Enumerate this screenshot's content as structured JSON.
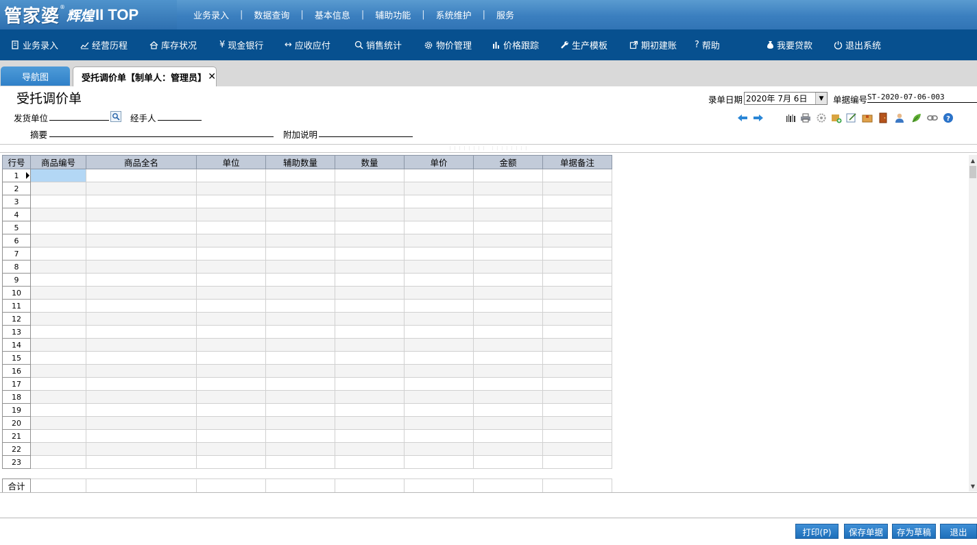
{
  "app": {
    "brand": "管家婆",
    "brand_mark": "®",
    "brand_sub": "辉煌",
    "brand_version": "II TOP"
  },
  "top_menu": [
    "业务录入",
    "数据查询",
    "基本信息",
    "辅助功能",
    "系统维护",
    "服务"
  ],
  "nav": [
    {
      "label": "业务录入",
      "icon": "doc-icon"
    },
    {
      "label": "经营历程",
      "icon": "trend-icon"
    },
    {
      "label": "库存状况",
      "icon": "home-icon"
    },
    {
      "label": "现金银行",
      "icon": "yen-icon"
    },
    {
      "label": "应收应付",
      "icon": "arrows-icon"
    },
    {
      "label": "销售统计",
      "icon": "search-icon"
    },
    {
      "label": "物价管理",
      "icon": "gear-icon"
    },
    {
      "label": "价格跟踪",
      "icon": "bar-chart-icon"
    },
    {
      "label": "生产模板",
      "icon": "wrench-icon"
    },
    {
      "label": "期初建账",
      "icon": "external-icon"
    },
    {
      "label": "帮助",
      "icon": "question-icon"
    },
    {
      "label": "我要贷款",
      "icon": "moneybag-icon"
    },
    {
      "label": "退出系统",
      "icon": "power-icon"
    }
  ],
  "tabs": {
    "nav_tab": "导航图",
    "active_tab": "受托调价单【制单人：管理员】",
    "close": "✕"
  },
  "form": {
    "title": "受托调价单",
    "shipper_label": "发货单位",
    "handler_label": "经手人",
    "summary_label": "摘要",
    "note_label": "附加说明",
    "date_label": "录单日期",
    "date_value": "2020年  7月  6日",
    "billno_label": "单据编号",
    "billno_value": "ST-2020-07-06-003"
  },
  "grid": {
    "columns": [
      "行号",
      "商品编号",
      "商品全名",
      "单位",
      "辅助数量",
      "数量",
      "单价",
      "金额",
      "单据备注"
    ],
    "rows": [
      "1",
      "2",
      "3",
      "4",
      "5",
      "6",
      "7",
      "8",
      "9",
      "10",
      "11",
      "12",
      "13",
      "14",
      "15",
      "16",
      "17",
      "18",
      "19",
      "20",
      "21",
      "22",
      "23"
    ],
    "total_label": "合计"
  },
  "buttons": {
    "print": "打印(P)",
    "save": "保存单据",
    "draft": "存为草稿",
    "exit": "退出"
  }
}
